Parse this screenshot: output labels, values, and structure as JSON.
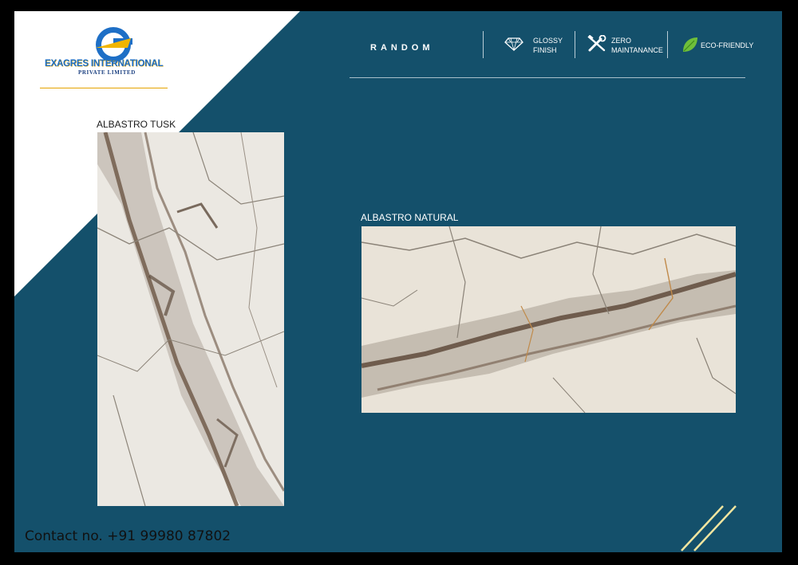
{
  "brand": {
    "name": "EXAGRES INTERNATIONAL",
    "subtitle": "PRIVATE LIMITED"
  },
  "header": {
    "series": "RANDOM",
    "features": [
      {
        "icon": "diamond-icon",
        "line1": "GLOSSY",
        "line2": "FINISH"
      },
      {
        "icon": "tools-icon",
        "line1": "ZERO",
        "line2": "MAINTANANCE"
      },
      {
        "icon": "leaf-icon",
        "line1": "ECO-FRIENDLY",
        "line2": ""
      }
    ]
  },
  "tiles": [
    {
      "label": "ALBASTRO TUSK"
    },
    {
      "label": "ALBASTRO NATURAL"
    }
  ],
  "contact": "Contact no. +91 99980 87802",
  "colors": {
    "panel": "#14506b",
    "accent": "#f2e6a0",
    "border": "#000000"
  }
}
